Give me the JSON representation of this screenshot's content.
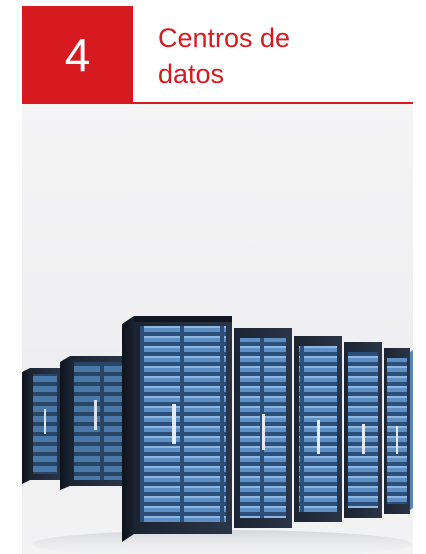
{
  "section": {
    "number": "4",
    "title_line1": "Centros de",
    "title_line2": "datos"
  },
  "image": {
    "subject": "server-racks-icon"
  },
  "colors": {
    "accent": "#d71920",
    "rack_dark": "#1b2635",
    "rack_light": "#3f6fa6"
  }
}
